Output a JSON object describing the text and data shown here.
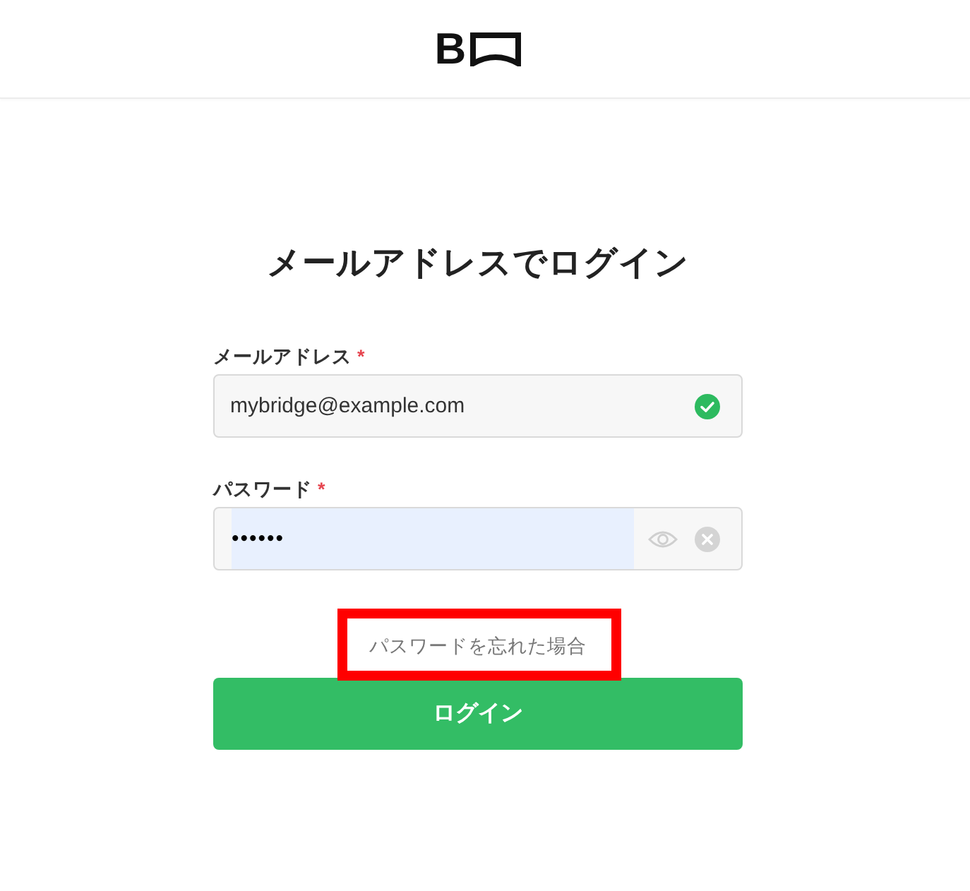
{
  "header": {
    "logo_text": "B"
  },
  "title": "メールアドレスでログイン",
  "fields": [
    {
      "kind": "email",
      "label": "メールアドレス",
      "required_mark": "*",
      "value": "mybridge@example.com",
      "valid": true,
      "autofilled": false
    },
    {
      "kind": "password",
      "label": "パスワード",
      "required_mark": "*",
      "value": "••••••",
      "autofilled": true
    }
  ],
  "forgot_link": {
    "text": "パスワードを忘れた場合",
    "highlighted": true
  },
  "submit_button": {
    "label": "ログイン"
  }
}
